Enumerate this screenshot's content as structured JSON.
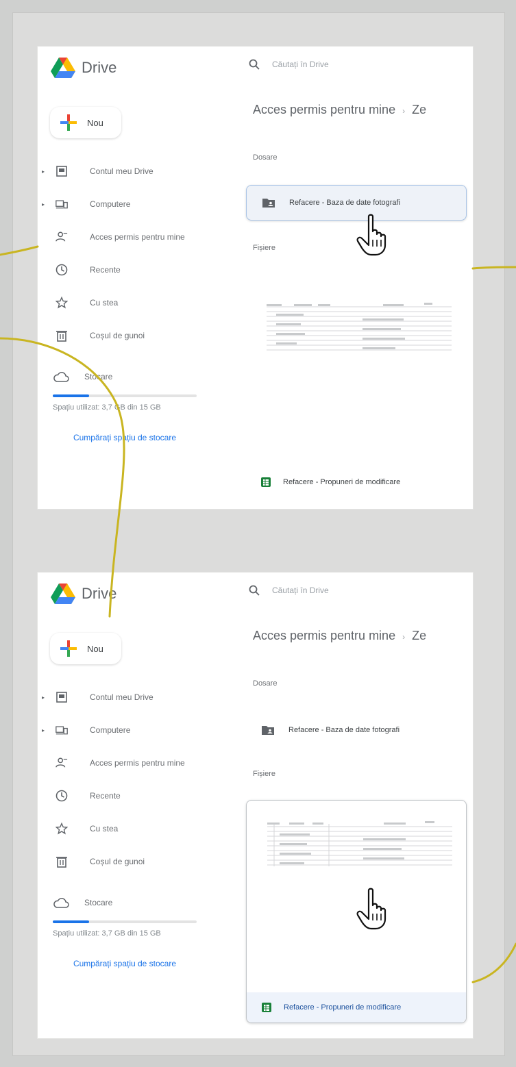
{
  "app": {
    "name": "Drive"
  },
  "panels": [
    {
      "search_placeholder": "Căutați în Drive",
      "new_label": "Nou",
      "nav": [
        {
          "label": "Contul meu Drive",
          "icon": "my-drive-icon",
          "caret": true
        },
        {
          "label": "Computere",
          "icon": "computers-icon",
          "caret": true
        },
        {
          "label": "Acces permis pentru mine",
          "icon": "shared-with-me-icon",
          "caret": false
        },
        {
          "label": "Recente",
          "icon": "recent-icon",
          "caret": false
        },
        {
          "label": "Cu stea",
          "icon": "starred-icon",
          "caret": false
        },
        {
          "label": "Coșul de gunoi",
          "icon": "trash-icon",
          "caret": false
        }
      ],
      "storage": {
        "label": "Stocare",
        "usage_text": "Spațiu utilizat: 3,7 GB din 15 GB",
        "used_fraction": 0.25,
        "buy_label": "Cumpărați spațiu de stocare"
      },
      "heading": "Acces permis pentru mine",
      "heading_next": "Ze",
      "folders_label": "Dosare",
      "files_label": "Fișiere",
      "folder_name": "Refacere - Baza de date fotografi",
      "file_name": "Refacere - Propuneri de modificare"
    },
    {
      "search_placeholder": "Căutați în Drive",
      "new_label": "Nou",
      "nav": [
        {
          "label": "Contul meu Drive",
          "icon": "my-drive-icon",
          "caret": true
        },
        {
          "label": "Computere",
          "icon": "computers-icon",
          "caret": true
        },
        {
          "label": "Acces permis pentru mine",
          "icon": "shared-with-me-icon",
          "caret": false
        },
        {
          "label": "Recente",
          "icon": "recent-icon",
          "caret": false
        },
        {
          "label": "Cu stea",
          "icon": "starred-icon",
          "caret": false
        },
        {
          "label": "Coșul de gunoi",
          "icon": "trash-icon",
          "caret": false
        }
      ],
      "storage": {
        "label": "Stocare",
        "usage_text": "Spațiu utilizat: 3,7 GB din 15 GB",
        "used_fraction": 0.25,
        "buy_label": "Cumpărați spațiu de stocare"
      },
      "heading": "Acces permis pentru mine",
      "heading_next": "Ze",
      "folders_label": "Dosare",
      "files_label": "Fișiere",
      "folder_name": "Refacere - Baza de date fotografi",
      "file_name": "Refacere - Propuneri de modificare"
    }
  ],
  "colors": {
    "accent_blue": "#1a73e8",
    "sheets_green": "#188038",
    "connector_yellow": "#c9b521"
  }
}
